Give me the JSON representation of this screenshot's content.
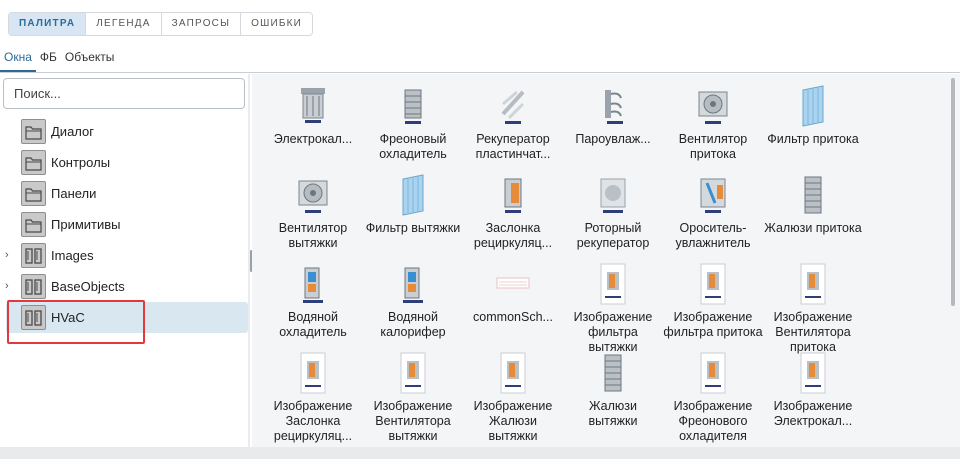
{
  "top_tabs": [
    "ПАЛИТРА",
    "ЛЕГЕНДА",
    "ЗАПРОСЫ",
    "ОШИБКИ"
  ],
  "sub_tabs": [
    "Окна",
    "ФБ",
    "Объекты"
  ],
  "search": {
    "placeholder": "Поиск..."
  },
  "tree": [
    {
      "label": "Диалог",
      "icon": "folder-icon",
      "expandable": false
    },
    {
      "label": "Контролы",
      "icon": "folder-icon",
      "expandable": false
    },
    {
      "label": "Панели",
      "icon": "folder-icon",
      "expandable": false
    },
    {
      "label": "Примитивы",
      "icon": "folder-icon",
      "expandable": false
    },
    {
      "label": "Images",
      "icon": "library-icon",
      "expandable": true
    },
    {
      "label": "BaseObjects",
      "icon": "library-icon",
      "expandable": true
    },
    {
      "label": "HVaC",
      "icon": "library-icon",
      "expandable": false,
      "selected": true
    }
  ],
  "palette": [
    {
      "label": "Электрокал...",
      "thumb": "heater"
    },
    {
      "label": "Фреоновый охладитель",
      "thumb": "cooler"
    },
    {
      "label": "Рекуператор пластинчат...",
      "thumb": "recuperator"
    },
    {
      "label": "Пароувлаж...",
      "thumb": "steam"
    },
    {
      "label": "Вентилятор притока",
      "thumb": "fan"
    },
    {
      "label": "Фильтр притока",
      "thumb": "filter"
    },
    {
      "label": "Вентилятор вытяжки",
      "thumb": "fan"
    },
    {
      "label": "Фильтр вытяжки",
      "thumb": "filter"
    },
    {
      "label": "Заслонка рециркуляц...",
      "thumb": "damper"
    },
    {
      "label": "Роторный рекуператор",
      "thumb": "rotor"
    },
    {
      "label": "Ороситель-увлажнитель",
      "thumb": "sprinkler"
    },
    {
      "label": "Жалюзи притока",
      "thumb": "louver"
    },
    {
      "label": "Водяной охладитель",
      "thumb": "water"
    },
    {
      "label": "Водяной калорифер",
      "thumb": "water"
    },
    {
      "label": "commonSch...",
      "thumb": "common"
    },
    {
      "label": "Изображение фильтра вытяжки",
      "thumb": "doc"
    },
    {
      "label": "Изображение фильтра притока",
      "thumb": "doc"
    },
    {
      "label": "Изображение Вентилятора притока",
      "thumb": "doc"
    },
    {
      "label": "Изображение Заслонка рециркуляц...",
      "thumb": "doc"
    },
    {
      "label": "Изображение Вентилятора вытяжки",
      "thumb": "doc"
    },
    {
      "label": "Изображение Жалюзи вытяжки",
      "thumb": "doc"
    },
    {
      "label": "Жалюзи вытяжки",
      "thumb": "louver"
    },
    {
      "label": "Изображение Фреонового охладителя",
      "thumb": "doc"
    },
    {
      "label": "Изображение Электрокал...",
      "thumb": "doc"
    }
  ],
  "colors": {
    "accent": "#2b6b9a",
    "selected_bg": "#d9e7f1",
    "highlight": "#e0393e",
    "palette_bg": "#f4f5f6"
  }
}
